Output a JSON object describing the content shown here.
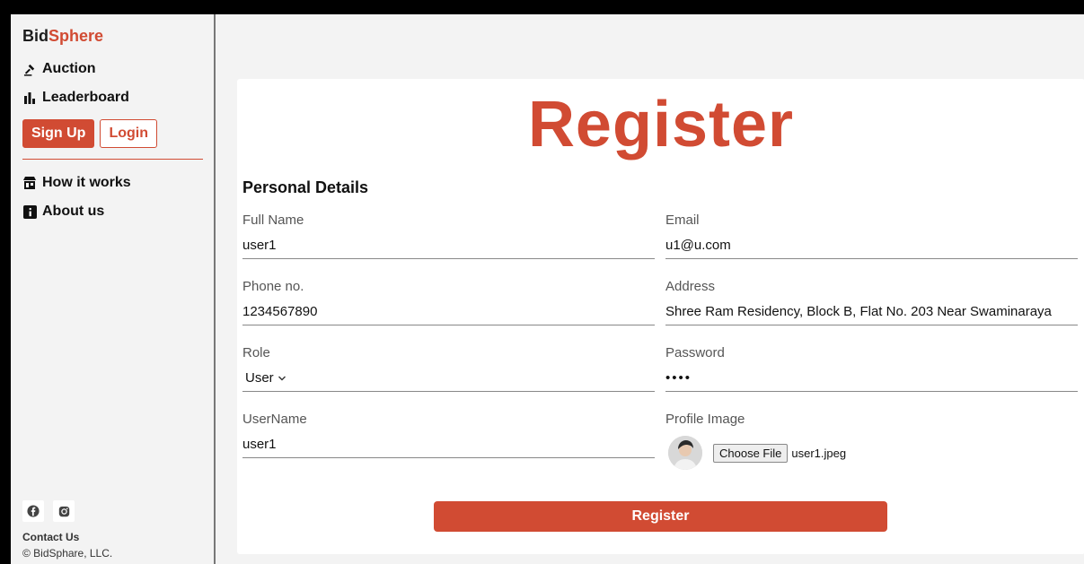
{
  "sidebar": {
    "brand_part1": "Bid",
    "brand_part2": "Sphere",
    "nav": [
      {
        "label": "Auction",
        "icon": "gavel-icon"
      },
      {
        "label": "Leaderboard",
        "icon": "bar-chart-icon"
      }
    ],
    "signup_label": "Sign Up",
    "login_label": "Login",
    "secondary_nav": [
      {
        "label": "How it works",
        "icon": "shop-icon"
      },
      {
        "label": "About us",
        "icon": "info-icon"
      }
    ],
    "contact_label": "Contact Us",
    "copyright": "© BidSphare, LLC."
  },
  "form": {
    "title": "Register",
    "section_title": "Personal Details",
    "full_name": {
      "label": "Full Name",
      "value": "user1"
    },
    "email": {
      "label": "Email",
      "value": "u1@u.com"
    },
    "phone": {
      "label": "Phone no.",
      "value": "1234567890"
    },
    "address": {
      "label": "Address",
      "value": "Shree Ram Residency, Block B, Flat No. 203 Near Swaminaraya"
    },
    "role": {
      "label": "Role",
      "value": "User"
    },
    "password": {
      "label": "Password",
      "value": "••••"
    },
    "username": {
      "label": "UserName",
      "value": "user1"
    },
    "profile_image": {
      "label": "Profile Image",
      "button_label": "Choose File",
      "file_name": "user1.jpeg"
    },
    "submit_label": "Register"
  },
  "colors": {
    "accent": "#d14b33",
    "background": "#f3f3f3",
    "card": "#ffffff"
  }
}
